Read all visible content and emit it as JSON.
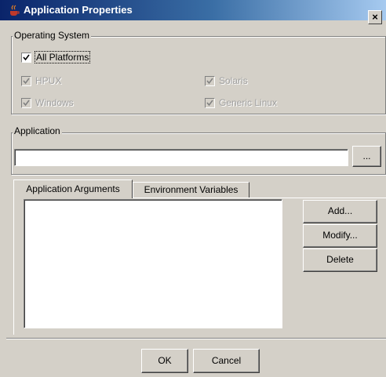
{
  "window": {
    "title": "Application Properties",
    "close_glyph": "×",
    "icon": "java-cup-icon"
  },
  "os_group": {
    "legend": "Operating System",
    "all_platforms": {
      "label": "All Platforms",
      "checked": true,
      "enabled": true
    },
    "platforms": [
      {
        "label": "HPUX",
        "checked": true,
        "enabled": false
      },
      {
        "label": "Solaris",
        "checked": true,
        "enabled": false
      },
      {
        "label": "Windows",
        "checked": true,
        "enabled": false
      },
      {
        "label": "Generic Linux",
        "checked": true,
        "enabled": false
      }
    ]
  },
  "application": {
    "legend": "Application",
    "value": "",
    "browse_label": "..."
  },
  "tabs": [
    {
      "label": "Application Arguments",
      "selected": true
    },
    {
      "label": "Environment Variables",
      "selected": false
    }
  ],
  "list_buttons": {
    "add": "Add...",
    "modify": "Modify...",
    "delete": "Delete"
  },
  "footer": {
    "ok": "OK",
    "cancel": "Cancel"
  },
  "colors": {
    "face": "#d4d0c8",
    "title_start": "#0a246a",
    "title_end": "#a6caf0"
  }
}
